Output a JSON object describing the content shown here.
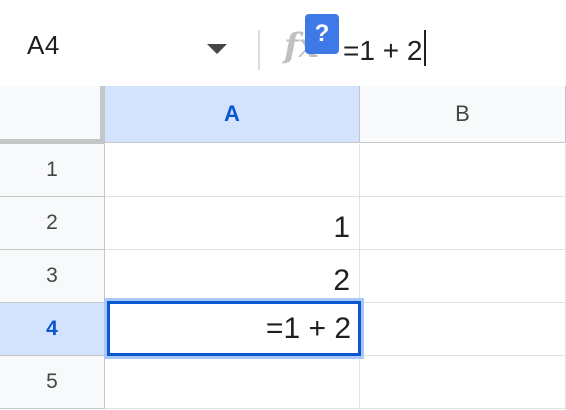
{
  "formula_bar": {
    "name_box": "A4",
    "fx_label": "fx",
    "help_label": "?",
    "formula": "=1 + 2"
  },
  "columns": [
    "A",
    "B"
  ],
  "rows": [
    "1",
    "2",
    "3",
    "4",
    "5"
  ],
  "cells": {
    "A1": "",
    "A2": "1",
    "A3": "2",
    "A4": "=1 + 2",
    "A5": "",
    "B1": "",
    "B2": "",
    "B3": "",
    "B4": "",
    "B5": ""
  },
  "selection": {
    "active_cell": "A4",
    "column": "A",
    "row": "4"
  },
  "colors": {
    "accent": "#0b57d0",
    "selected_header": "#d3e3fd",
    "help_badge": "#3f79e8"
  }
}
